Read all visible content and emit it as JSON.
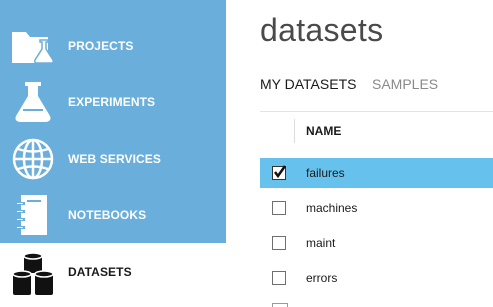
{
  "sidebar": {
    "items": [
      {
        "label": "PROJECTS",
        "icon": "projects-folder-flask-icon"
      },
      {
        "label": "EXPERIMENTS",
        "icon": "flask-icon"
      },
      {
        "label": "WEB SERVICES",
        "icon": "globe-icon"
      },
      {
        "label": "NOTEBOOKS",
        "icon": "notebook-icon"
      },
      {
        "label": "DATASETS",
        "icon": "datasets-cylinders-icon",
        "active": true
      }
    ]
  },
  "main": {
    "title": "datasets",
    "tabs": [
      {
        "label": "MY DATASETS",
        "active": true
      },
      {
        "label": "SAMPLES",
        "active": false
      }
    ],
    "table": {
      "columns": [
        "NAME"
      ],
      "rows": [
        {
          "name": "failures",
          "checked": true,
          "selected": true
        },
        {
          "name": "machines",
          "checked": false,
          "selected": false
        },
        {
          "name": "maint",
          "checked": false,
          "selected": false
        },
        {
          "name": "errors",
          "checked": false,
          "selected": false
        }
      ]
    }
  },
  "colors": {
    "sidebar_bg": "#6aaedb",
    "selected_row": "#66c2ec",
    "title_text": "#4a4a4a"
  }
}
